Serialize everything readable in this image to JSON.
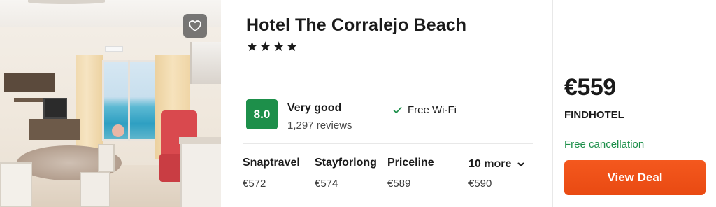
{
  "hotel": {
    "name": "Hotel The Corralejo Beach",
    "stars": "★★★★"
  },
  "rating": {
    "score": "8.0",
    "label": "Very good",
    "reviews": "1,297 reviews",
    "badge_color": "#1d8f4a"
  },
  "amenities": [
    {
      "icon": "check-icon",
      "label": "Free Wi-Fi"
    }
  ],
  "providers": [
    {
      "name": "Snaptravel",
      "price": "€572"
    },
    {
      "name": "Stayforlong",
      "price": "€574"
    },
    {
      "name": "Priceline",
      "price": "€589"
    }
  ],
  "more_deals": {
    "label": "10 more",
    "price": "€590",
    "icon": "chevron-down-icon"
  },
  "best_deal": {
    "price": "€559",
    "provider": "FINDHOTEL",
    "cancellation": "Free cancellation",
    "button_label": "View Deal",
    "button_color": "#f4581e",
    "cancellation_color": "#1d8f4a"
  },
  "photo": {
    "favorite_icon": "heart-icon"
  }
}
